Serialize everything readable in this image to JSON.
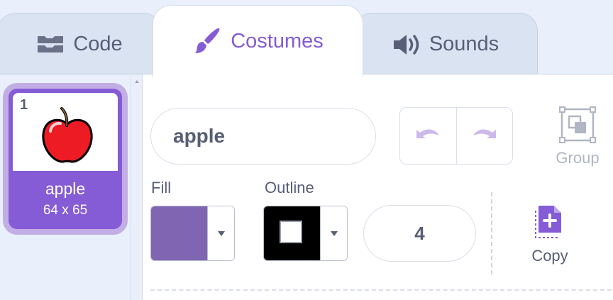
{
  "tabs": {
    "code": {
      "label": "Code",
      "icon": "code-blocks-icon"
    },
    "costumes": {
      "label": "Costumes",
      "icon": "paintbrush-icon",
      "active": true
    },
    "sounds": {
      "label": "Sounds",
      "icon": "speaker-icon"
    }
  },
  "costume_list": {
    "items": [
      {
        "number": "1",
        "name": "apple",
        "size": "64 x 65",
        "selected": true,
        "thumbnail_icon": "apple-icon"
      }
    ]
  },
  "editor": {
    "costume_name": "apple",
    "undo_icon": "undo-icon",
    "redo_icon": "redo-icon",
    "group_label": "Group",
    "fill_label": "Fill",
    "outline_label": "Outline",
    "outline_width": "4",
    "copy_label": "Copy"
  },
  "colors": {
    "accent": "#855cd6",
    "fill_color": "#7f65b2",
    "outline_color": "#000000",
    "text": "#575e75",
    "tab_inactive_bg": "#d9e3f2",
    "panel_bg": "#e9f0fb"
  }
}
